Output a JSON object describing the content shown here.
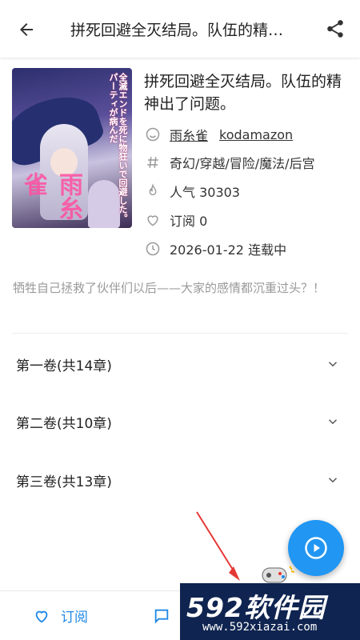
{
  "appbar": {
    "title": "拼死回避全灭结局。队伍的精神出了问题。"
  },
  "book": {
    "cover_text": "全滅エンドを死に物狂いで回避した。パーティが病んだ",
    "cover_author": "雨糸雀",
    "title": "拼死回避全灭结局。队伍的精神出了问题。",
    "author": "雨糸雀",
    "illustrator": "kodamazon",
    "tags": "奇幻/穿越/冒险/魔法/后宫",
    "popularity": "人气 30303",
    "subscriptions": "订阅 0",
    "status": "2026-01-22 连载中",
    "description": "牺牲自己拯救了伙伴们以后——大家的感情都沉重过头？！"
  },
  "volumes": [
    {
      "label": "第一卷(共14章)"
    },
    {
      "label": "第二卷(共10章)"
    },
    {
      "label": "第三卷(共13章)"
    }
  ],
  "bottom": {
    "subscribe_label": "订阅"
  },
  "watermark": {
    "brand": "592软件园",
    "url": "www.592xiazai.com"
  },
  "colors": {
    "accent": "#2196f3",
    "link_blue": "#1e88e5",
    "muted_text": "#9a9a9a"
  }
}
